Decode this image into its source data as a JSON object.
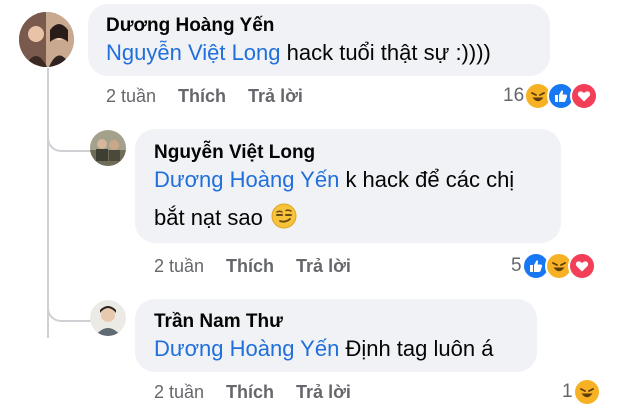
{
  "comments": [
    {
      "author": "Dương Hoàng Yến",
      "mention": "Nguyễn Việt Long",
      "text": " hack tuổi thật sự :))))",
      "time": "2 tuần",
      "like": "Thích",
      "reply": "Trả lời",
      "reaction_count": "16",
      "reactions": [
        "haha-icon",
        "like-icon",
        "love-icon"
      ]
    },
    {
      "author": "Nguyễn Việt Long",
      "mention": "Dương Hoàng Yến",
      "text_line1": " k hack để các chị",
      "text_line2": "bắt nạt sao ",
      "emoji": "smirk-emoji",
      "time": "2 tuần",
      "like": "Thích",
      "reply": "Trả lời",
      "reaction_count": "5",
      "reactions": [
        "like-icon",
        "haha-icon",
        "love-icon"
      ]
    },
    {
      "author": "Trần Nam Thư",
      "mention": "Dương Hoàng Yến",
      "text": " Định tag luôn á",
      "time": "2 tuần",
      "like": "Thích",
      "reply": "Trả lời",
      "reaction_count": "1",
      "reactions": [
        "haha-icon"
      ]
    }
  ],
  "colors": {
    "mention": "#216fdb",
    "bubble": "#f0f2f5",
    "meta": "#65676b",
    "like": "#1877f2",
    "love": "#f33e58",
    "haha": "#f7b125"
  }
}
